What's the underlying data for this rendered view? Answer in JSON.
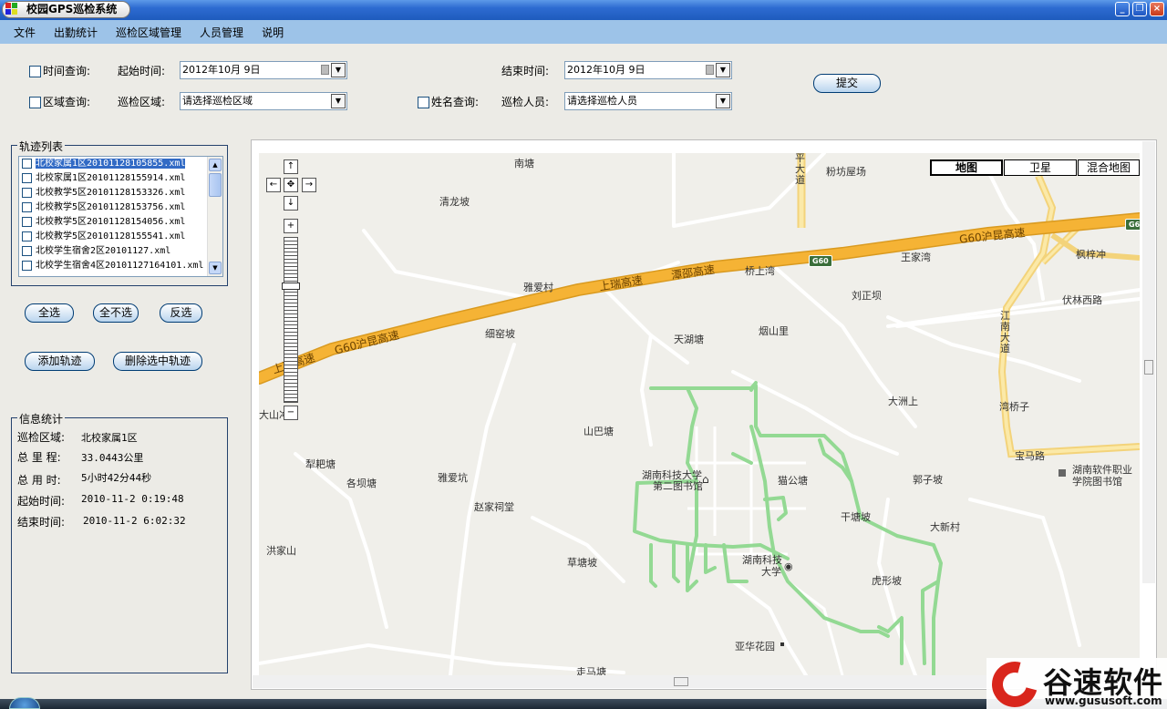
{
  "window": {
    "title": "校园GPS巡检系统"
  },
  "menu": [
    "文件",
    "出勤统计",
    "巡检区域管理",
    "人员管理",
    "说明"
  ],
  "query": {
    "time_query_label": "时间查询:",
    "start_time_label": "起始时间:",
    "start_time_value": "2012年10月 9日",
    "end_time_label": "结束时间:",
    "end_time_value": "2012年10月 9日",
    "submit_label": "提交",
    "area_query_label": "区域查询:",
    "area_label": "巡检区域:",
    "area_placeholder": "请选择巡检区域",
    "name_query_label": "姓名查询:",
    "person_label": "巡检人员:",
    "person_placeholder": "请选择巡检人员"
  },
  "track_list": {
    "title": "轨迹列表",
    "items": [
      "北校家属1区20101128105855.xml",
      "北校家属1区20101128155914.xml",
      "北校教学5区20101128153326.xml",
      "北校教学5区20101128153756.xml",
      "北校教学5区20101128154056.xml",
      "北校教学5区20101128155541.xml",
      "北校学生宿舍2区20101127.xml",
      "北校学生宿舍4区20101127164101.xml"
    ],
    "select_all": "全选",
    "select_none": "全不选",
    "invert": "反选",
    "add_track": "添加轨迹",
    "delete_selected": "删除选中轨迹"
  },
  "info": {
    "title": "信息统计",
    "rows": [
      {
        "label": "巡检区域:",
        "value": "北校家属1区"
      },
      {
        "label": "总 里 程:",
        "value": "33.0443公里"
      },
      {
        "label": "总 用 时:",
        "value": "5小时42分44秒"
      },
      {
        "label": "起始时间:",
        "value": "2010-11-2 0:19:48"
      },
      {
        "label": "结束时间:",
        "value": "2010-11-2 6:02:32"
      }
    ]
  },
  "map": {
    "types": [
      "地图",
      "卫星",
      "混合地图"
    ],
    "active_type": "地图",
    "labels": {
      "nantang": "南塘",
      "pingdadao": "平大道",
      "fenfang": "粉坊屋场",
      "qinglongpo": "清龙坡",
      "wangjiawan": "王家湾",
      "fengzichong": "枫梓冲",
      "qiaoshangwan": "桥上湾",
      "liuzhengba": "刘正坝",
      "fulinxilu": "伏林西路",
      "yaaicun": "雅爱村",
      "xiyaopo": "细窑坡",
      "tianhutang": "天湖塘",
      "yanshanli": "烟山里",
      "jiangnandadao": "江南大道",
      "dashanchong": "大山冲",
      "dazhoushang": "大洲上",
      "wanqiaozi": "湾桥子",
      "shanbatang": "山巴塘",
      "baomalu": "宝马路",
      "libatang": "犁耙塘",
      "gebatang": "各坝塘",
      "yaaikeng": "雅爱坑",
      "hunan_lib2": "湖南科技大学",
      "hunan_lib2b": "第二图书馆",
      "maogongtang": "猫公塘",
      "guozipo": "郭子坡",
      "hunan_soft": "湖南软件职业",
      "hunan_soft_lib": "学院图书馆",
      "zhaojiacitang": "赵家祠堂",
      "gantangpo": "干塘坡",
      "daxincun": "大新村",
      "hongjiashan": "洪家山",
      "caotangpo": "草塘坡",
      "hunan_univ": "湖南科技",
      "hunan_univ2": "大学",
      "huxingpo": "虎形坡",
      "yahuahuayuan": "亚华花园",
      "zoumatang": "走马塘"
    },
    "roads": {
      "g60_upper": "G60沪昆高速",
      "shangrui1": "上瑞高速",
      "tanshao": "潭邵高速",
      "g60_lower": "G60沪昆高速",
      "shangrui2": "上瑞高速",
      "badge": "G60"
    }
  },
  "watermark": {
    "name": "谷速软件",
    "url": "www.gususoft.com"
  },
  "colors": {
    "titlebar": "#2d6bd1",
    "menubar": "#9dc3e8",
    "highway": "#f5b335",
    "track": "#8fd88f",
    "selection": "#316ac5",
    "watermark_red": "#d9261c"
  }
}
